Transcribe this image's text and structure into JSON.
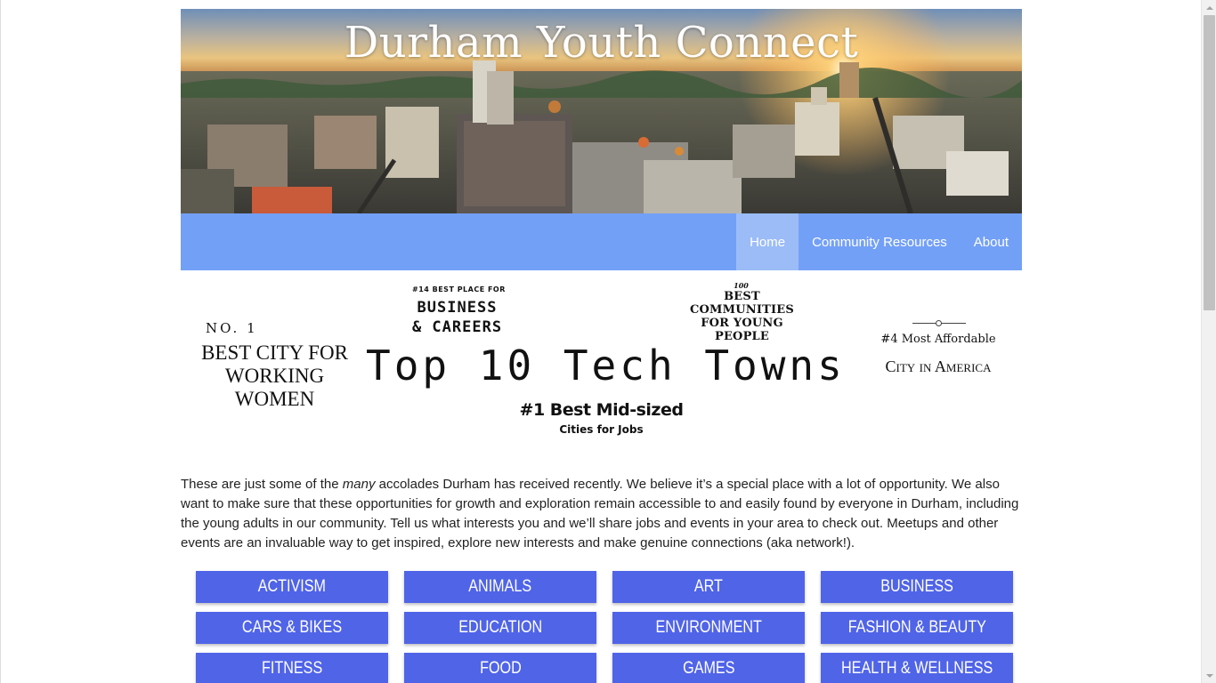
{
  "header": {
    "title": "Durham Youth Connect",
    "image_alt": "Aerial view of downtown Durham skyline at sunset"
  },
  "nav": {
    "items": [
      {
        "label": "Home",
        "active": true
      },
      {
        "label": "Community Resources",
        "active": false
      },
      {
        "label": "About",
        "active": false
      }
    ]
  },
  "accolades": {
    "no1_small": "NO. 1",
    "no1_big": "BEST CITY FOR WORKING WOMEN",
    "business_small": "#14 BEST PLACE FOR",
    "business_big": "BUSINESS & CAREERS",
    "tech": "Top 10 Tech Towns",
    "midsize_big": "#1 Best Mid-sized",
    "midsize_small": "Cities for Jobs",
    "communities_small": "100",
    "communities_big": "BEST COMMUNITIES FOR YOUNG PEOPLE",
    "affordable_small": "#4 Most Affordable",
    "affordable_big": "City in America"
  },
  "intro": {
    "before_em": "These are just some of the ",
    "em": "many",
    "after_em": " accolades Durham has received recently. We believe it’s a special place with a lot of opportunity. We also want to make sure that these opportunities for growth and exploration remain accessible to and easily found by everyone in Durham, including the young adults in our community. Tell us what interests you and we’ll share jobs and events in your area to check out. Meetups and other events are an invaluable way to get inspired, explore new interests and make genuine connections (aka network!)."
  },
  "categories": [
    "ACTIVISM",
    "ANIMALS",
    "ART",
    "BUSINESS",
    "CARS & BIKES",
    "EDUCATION",
    "ENVIRONMENT",
    "FASHION & BEAUTY",
    "FITNESS",
    "FOOD",
    "GAMES",
    "HEALTH & WELLNESS"
  ],
  "colors": {
    "nav_bg": "#73a0f7",
    "nav_active": "#9bbcf7",
    "category_button": "#5064e8"
  }
}
